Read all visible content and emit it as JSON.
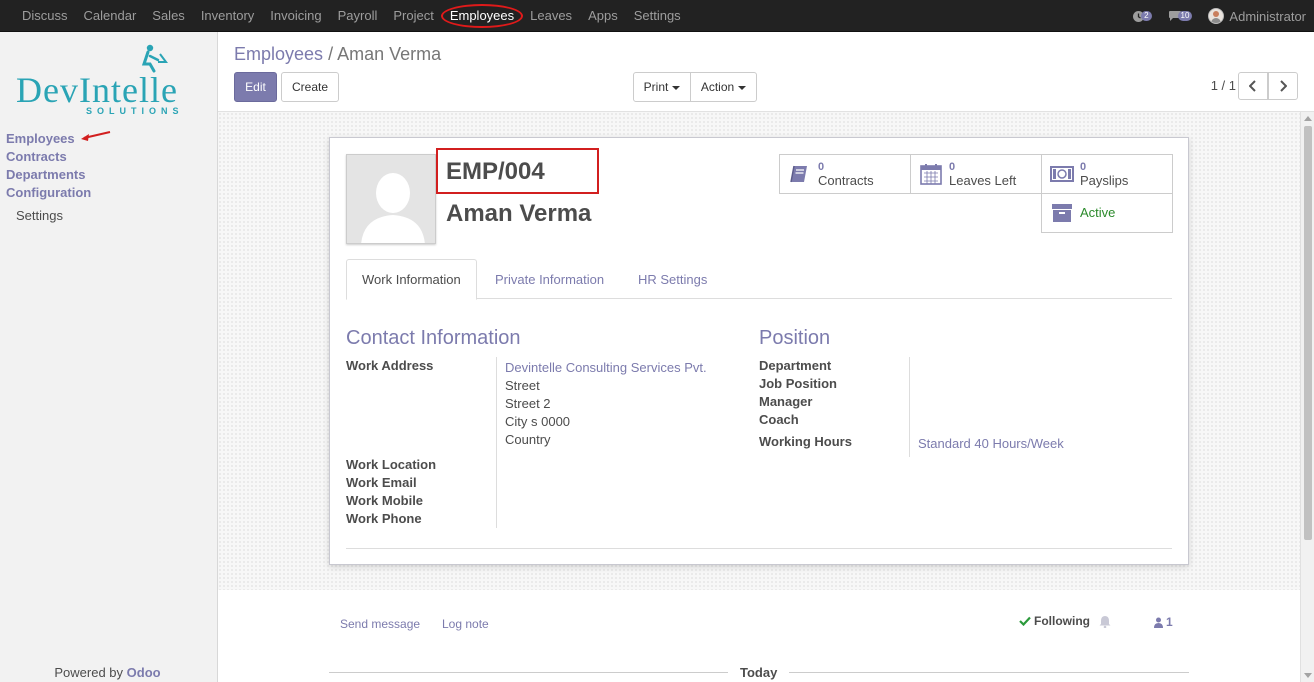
{
  "topbar": {
    "menu": [
      {
        "label": "Discuss",
        "active": false
      },
      {
        "label": "Calendar",
        "active": false
      },
      {
        "label": "Sales",
        "active": false
      },
      {
        "label": "Inventory",
        "active": false
      },
      {
        "label": "Invoicing",
        "active": false
      },
      {
        "label": "Payroll",
        "active": false
      },
      {
        "label": "Project",
        "active": false
      },
      {
        "label": "Employees",
        "active": true
      },
      {
        "label": "Leaves",
        "active": false
      },
      {
        "label": "Apps",
        "active": false
      },
      {
        "label": "Settings",
        "active": false
      }
    ],
    "activity_count": "2",
    "message_count": "10",
    "user": "Administrator"
  },
  "sidebar": {
    "logo_main": "DevIntelle",
    "logo_sub": "SOLUTIONS",
    "items": [
      "Employees",
      "Contracts",
      "Departments",
      "Configuration"
    ],
    "settings": "Settings",
    "powered_by": "Powered by",
    "powered_brand": "Odoo"
  },
  "control": {
    "breadcrumb_parent": "Employees",
    "breadcrumb_sep": "/",
    "breadcrumb_current": "Aman Verma",
    "edit_label": "Edit",
    "create_label": "Create",
    "print_label": "Print",
    "action_label": "Action",
    "pager": "1 / 1"
  },
  "employee": {
    "code": "EMP/004",
    "name": "Aman Verma"
  },
  "smart_buttons": {
    "contracts": {
      "count": "0",
      "label": "Contracts"
    },
    "leaves": {
      "count": "0",
      "label": "Leaves Left"
    },
    "payslips": {
      "count": "0",
      "label": "Payslips"
    },
    "active": {
      "label": "Active"
    }
  },
  "tabs": [
    "Work Information",
    "Private Information",
    "HR Settings"
  ],
  "contact": {
    "title": "Contact Information",
    "work_address_label": "Work Address",
    "address_lines": [
      "Devintelle Consulting Services Pvt.",
      "Street",
      "Street 2",
      "City s 0000",
      "Country"
    ],
    "work_location_label": "Work Location",
    "work_email_label": "Work Email",
    "work_mobile_label": "Work Mobile",
    "work_phone_label": "Work Phone"
  },
  "position": {
    "title": "Position",
    "department_label": "Department",
    "job_position_label": "Job Position",
    "manager_label": "Manager",
    "coach_label": "Coach",
    "working_hours_label": "Working Hours",
    "working_hours_value": "Standard 40 Hours/Week"
  },
  "chatter": {
    "send_message": "Send message",
    "log_note": "Log note",
    "following": "Following",
    "followers_count": "1",
    "today": "Today"
  },
  "colors": {
    "accent": "#7c7bad",
    "topbar": "#222222",
    "highlight": "#d21f1f",
    "active_status": "#2b8a2b"
  }
}
